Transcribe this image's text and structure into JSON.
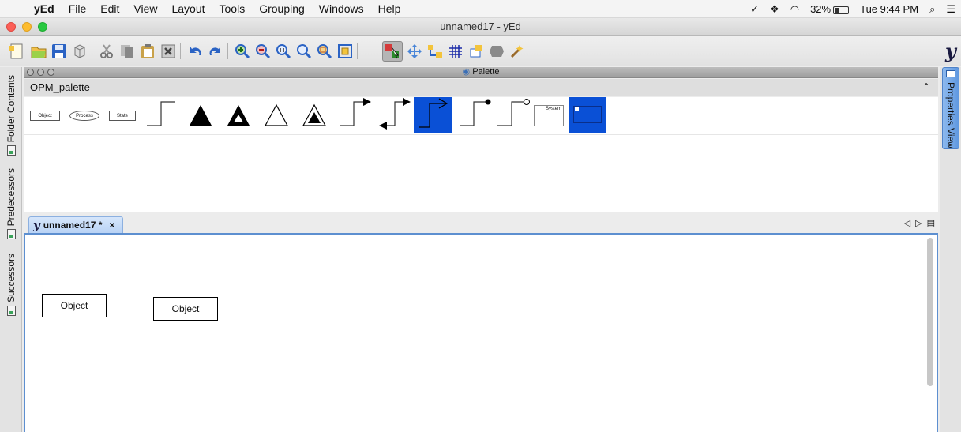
{
  "menubar": {
    "app": "yEd",
    "menus": [
      "File",
      "Edit",
      "View",
      "Layout",
      "Tools",
      "Grouping",
      "Windows",
      "Help"
    ],
    "status": {
      "battery": "32%",
      "clock": "Tue 9:44 PM"
    }
  },
  "window": {
    "title": "unnamed17 - yEd"
  },
  "toolbar": {
    "icons": [
      "new-document-icon",
      "open-folder-icon",
      "save-icon",
      "3d-box-icon",
      "cut-icon",
      "copy-icon",
      "paste-icon",
      "delete-icon",
      "undo-icon",
      "redo-icon",
      "zoom-in-icon",
      "zoom-out-icon",
      "zoom-actual-icon",
      "zoom-selection-icon",
      "zoom-fit-icon",
      "fit-content-icon",
      "edit-mode-icon",
      "navigate-mode-icon",
      "hierarchy-icon",
      "grid-icon",
      "label-icon",
      "group-icon",
      "layout-wizard-icon"
    ],
    "active": "edit-mode-icon"
  },
  "palette": {
    "window_title": "Palette",
    "section_name": "OPM_palette",
    "items": {
      "object_label": "Object",
      "process_label": "Process",
      "state_label": "State",
      "system_label": "System"
    }
  },
  "left_dock": {
    "tabs": [
      "Folder Contents",
      "Predecessors",
      "Successors"
    ]
  },
  "right_dock": {
    "tab": "Properties View"
  },
  "document": {
    "tab_name": "unnamed17 *",
    "close_glyph": "×",
    "nodes": [
      {
        "label": "Object"
      },
      {
        "label": "Object"
      }
    ]
  }
}
